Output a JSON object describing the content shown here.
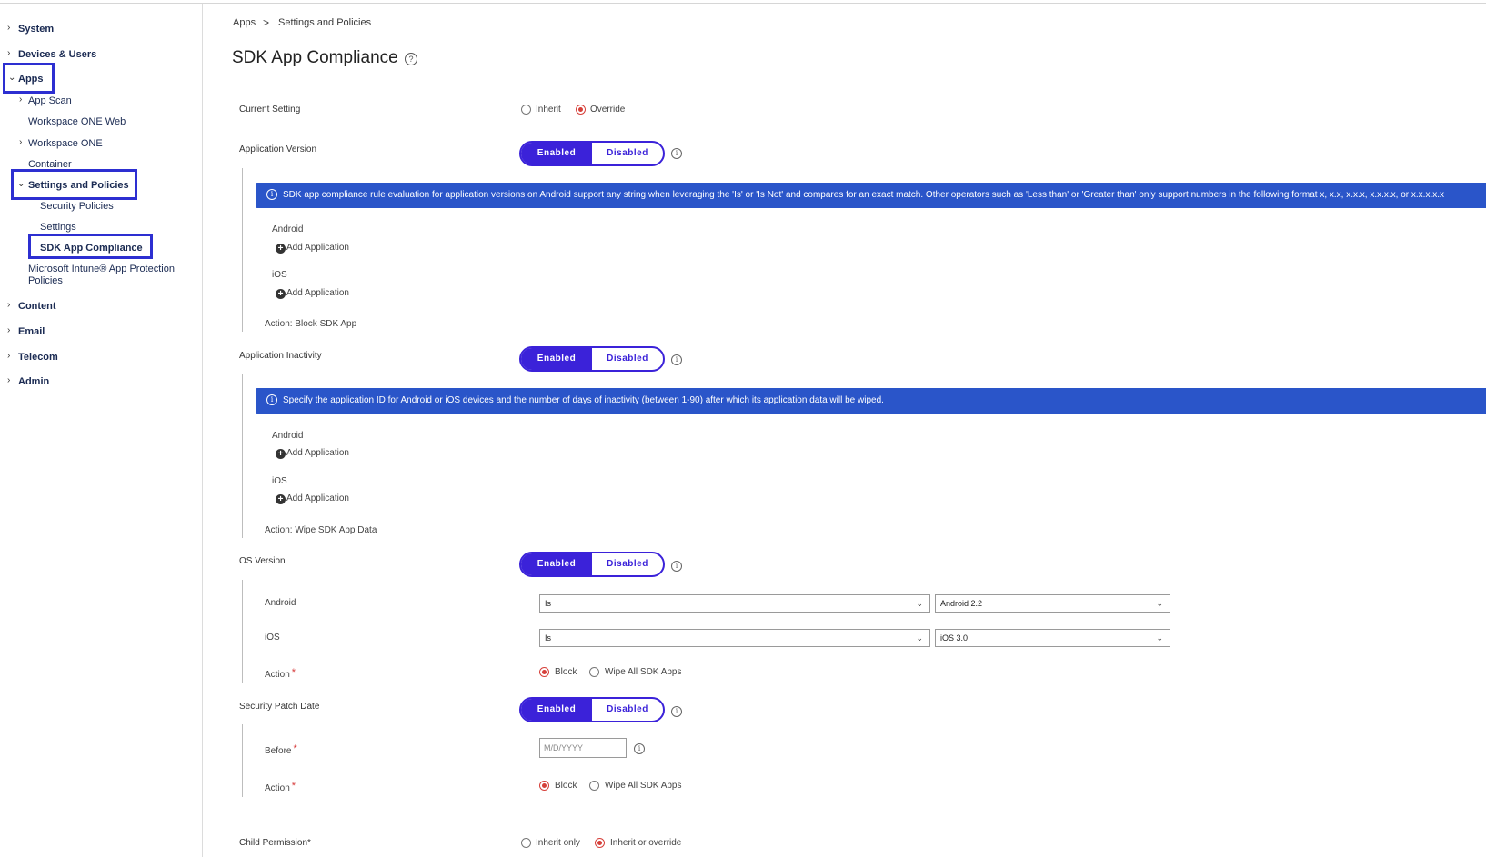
{
  "sidebar": {
    "system": "System",
    "devices_users": "Devices & Users",
    "apps": "Apps",
    "app_scan": "App Scan",
    "workspace_one_web": "Workspace ONE Web",
    "workspace_one": "Workspace ONE",
    "container": "Container",
    "settings_policies": "Settings and Policies",
    "security_policies": "Security Policies",
    "settings": "Settings",
    "sdk_app_compliance": "SDK App Compliance",
    "intune_line1": "Microsoft Intune® App Protection",
    "intune_line2": "Policies",
    "content": "Content",
    "email": "Email",
    "telecom": "Telecom",
    "admin": "Admin"
  },
  "breadcrumb": {
    "apps": "Apps",
    "sep": ">",
    "settings_policies": "Settings and Policies"
  },
  "page_title": "SDK App Compliance",
  "current_setting": {
    "label": "Current Setting",
    "inherit": "Inherit",
    "override": "Override",
    "selected": "override"
  },
  "toggle": {
    "enabled": "Enabled",
    "disabled": "Disabled"
  },
  "app_version": {
    "label": "Application Version",
    "banner": "SDK app compliance rule evaluation for application versions on Android support any string when leveraging the 'Is' or 'Is Not' and compares for an exact match. Other operators such as 'Less than' or 'Greater than' only support numbers in the following format x, x.x, x.x.x, x.x.x.x, or x.x.x.x.x",
    "android": "Android",
    "ios": "iOS",
    "add_application": "Add Application",
    "action": "Action: Block SDK App"
  },
  "app_inactivity": {
    "label": "Application Inactivity",
    "banner": "Specify the application ID for Android or iOS devices and the number of days of inactivity (between 1-90) after which its application data will be wiped.",
    "android": "Android",
    "ios": "iOS",
    "add_application": "Add Application",
    "action": "Action: Wipe SDK App Data"
  },
  "os_version": {
    "label": "OS Version",
    "android": "Android",
    "ios": "iOS",
    "android_operator": "Is",
    "android_value": "Android 2.2",
    "ios_operator": "Is",
    "ios_value": "iOS 3.0",
    "action_label": "Action",
    "block": "Block",
    "wipe": "Wipe All SDK Apps"
  },
  "security_patch": {
    "label": "Security Patch Date",
    "before_label": "Before",
    "date_placeholder": "M/D/YYYY",
    "action_label": "Action",
    "block": "Block",
    "wipe": "Wipe All SDK Apps"
  },
  "child_permission": {
    "label": "Child Permission*",
    "inherit_only": "Inherit only",
    "inherit_override": "Inherit or override",
    "selected": "inherit_override"
  },
  "colors": {
    "accent": "#3b22d9",
    "banner": "#2a55c9",
    "highlight": "#2d2fd1",
    "radio_on": "#d6403a"
  }
}
